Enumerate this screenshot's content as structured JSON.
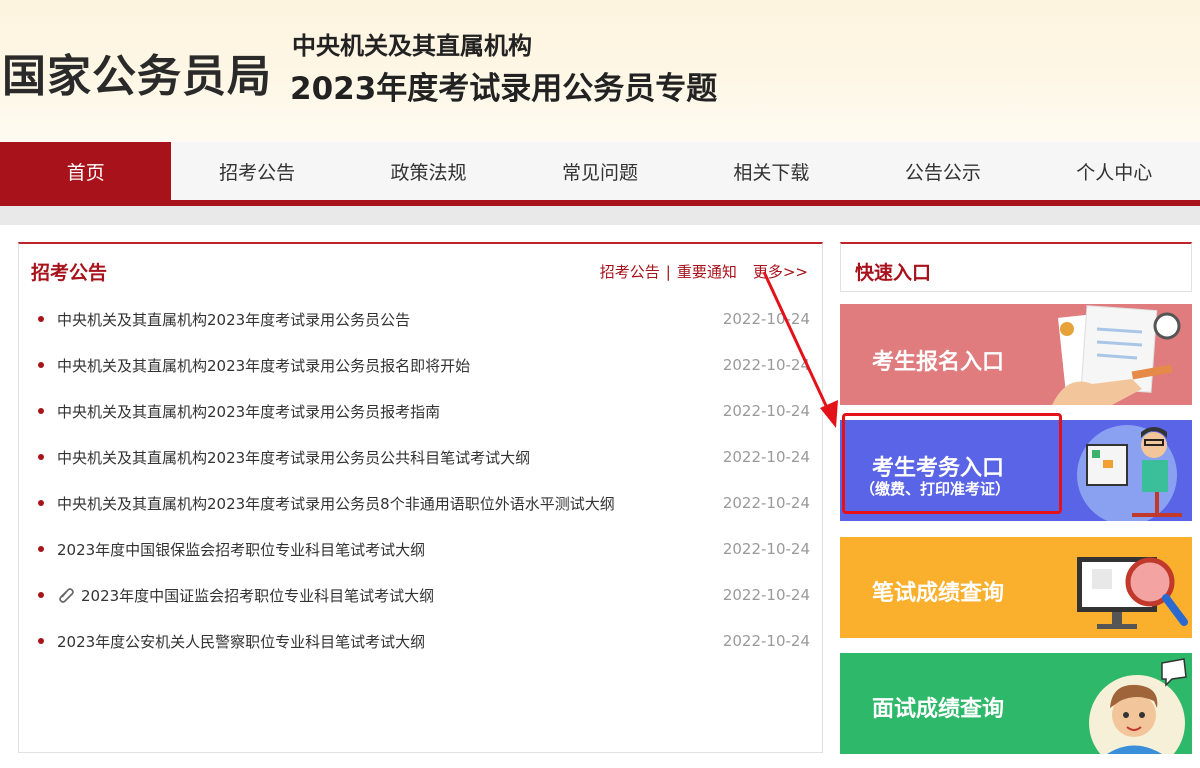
{
  "header": {
    "logo": "国家公务员局",
    "subtitle_line1": "中央机关及其直属机构",
    "subtitle_line2": "2023年度考试录用公务员专题"
  },
  "nav": {
    "items": [
      "首页",
      "招考公告",
      "政策法规",
      "常见问题",
      "相关下载",
      "公告公示",
      "个人中心"
    ],
    "active_index": 0
  },
  "announcements": {
    "title": "招考公告",
    "links": [
      "招考公告",
      "重要通知"
    ],
    "separator": "|",
    "more": "更多>>",
    "items": [
      {
        "text": "中央机关及其直属机构2023年度考试录用公务员公告",
        "date": "2022-10-24"
      },
      {
        "text": "中央机关及其直属机构2023年度考试录用公务员报名即将开始",
        "date": "2022-10-24"
      },
      {
        "text": "中央机关及其直属机构2023年度考试录用公务员报考指南",
        "date": "2022-10-24"
      },
      {
        "text": "中央机关及其直属机构2023年度考试录用公务员公共科目笔试考试大纲",
        "date": "2022-10-24"
      },
      {
        "text": "中央机关及其直属机构2023年度考试录用公务员8个非通用语职位外语水平测试大纲",
        "date": "2022-10-24"
      },
      {
        "text": "2023年度中国银保监会招考职位专业科目笔试考试大纲",
        "date": "2022-10-24"
      },
      {
        "text": "2023年度中国证监会招考职位专业科目笔试考试大纲",
        "date": "2022-10-24",
        "icon": "paperclip-icon"
      },
      {
        "text": "2023年度公安机关人民警察职位专业科目笔试考试大纲",
        "date": "2022-10-24"
      }
    ]
  },
  "quick_entry": {
    "title": "快速入口",
    "cards": [
      {
        "label": "考生报名入口",
        "color": "#e07b7e",
        "icon": "application-form-icon"
      },
      {
        "label": "考生考务入口",
        "sub": "（缴费、打印准考证）",
        "color": "#5a64e6",
        "icon": "computer-user-icon"
      },
      {
        "label": "笔试成绩查询",
        "color": "#fbb02d",
        "icon": "magnifier-monitor-icon"
      },
      {
        "label": "面试成绩查询",
        "color": "#2eb86a",
        "icon": "interview-person-icon"
      }
    ]
  },
  "annotation": {
    "color": "#e3121a"
  },
  "colors": {
    "brand_red": "#a8121b",
    "header_bg": "#fdf4df",
    "date_gray": "#9a9a9a"
  }
}
